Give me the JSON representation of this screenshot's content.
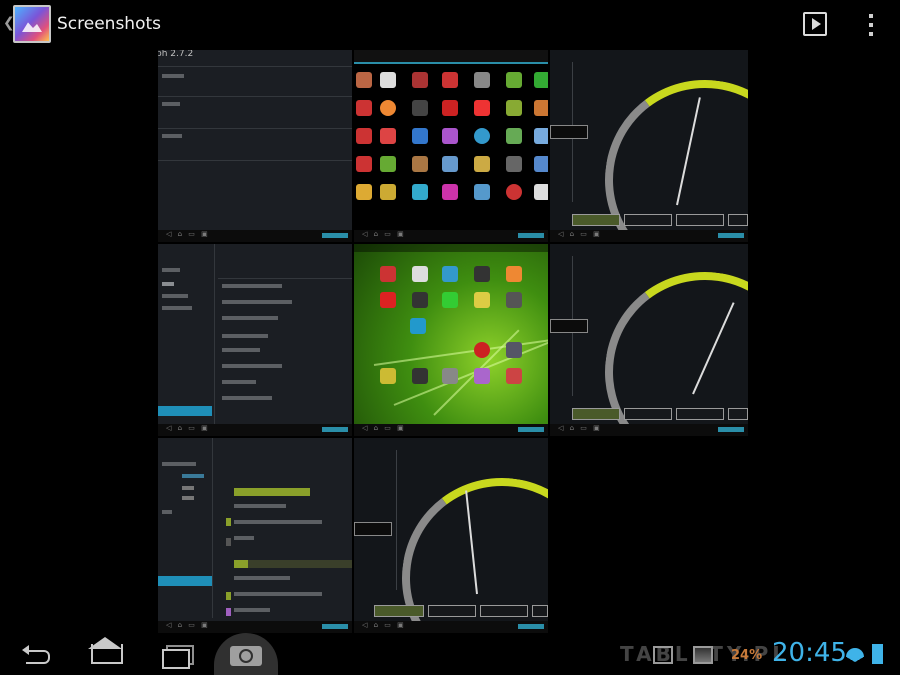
{
  "actionbar": {
    "title": "Screenshots",
    "icons": {
      "up": "chevron-left-icon",
      "app": "gallery-icon",
      "slideshow": "play-icon",
      "overflow": "overflow-menu-icon"
    }
  },
  "thumbnails": [
    {
      "name": "settings-screenshot-1",
      "header": "ph 2.7.2"
    },
    {
      "name": "app-drawer-screenshot"
    },
    {
      "name": "gauge-screenshot-1"
    },
    {
      "name": "settings-screenshot-2"
    },
    {
      "name": "homescreen-screenshot"
    },
    {
      "name": "gauge-screenshot-2"
    },
    {
      "name": "settings-screenshot-3"
    },
    {
      "name": "gauge-screenshot-3"
    }
  ],
  "statusbar": {
    "battery_percent": "24%",
    "clock": "20:45",
    "watermark": "TABLETY.PL"
  },
  "colors": {
    "accent": "#3fb3e8",
    "battery": "#c77a3a"
  }
}
